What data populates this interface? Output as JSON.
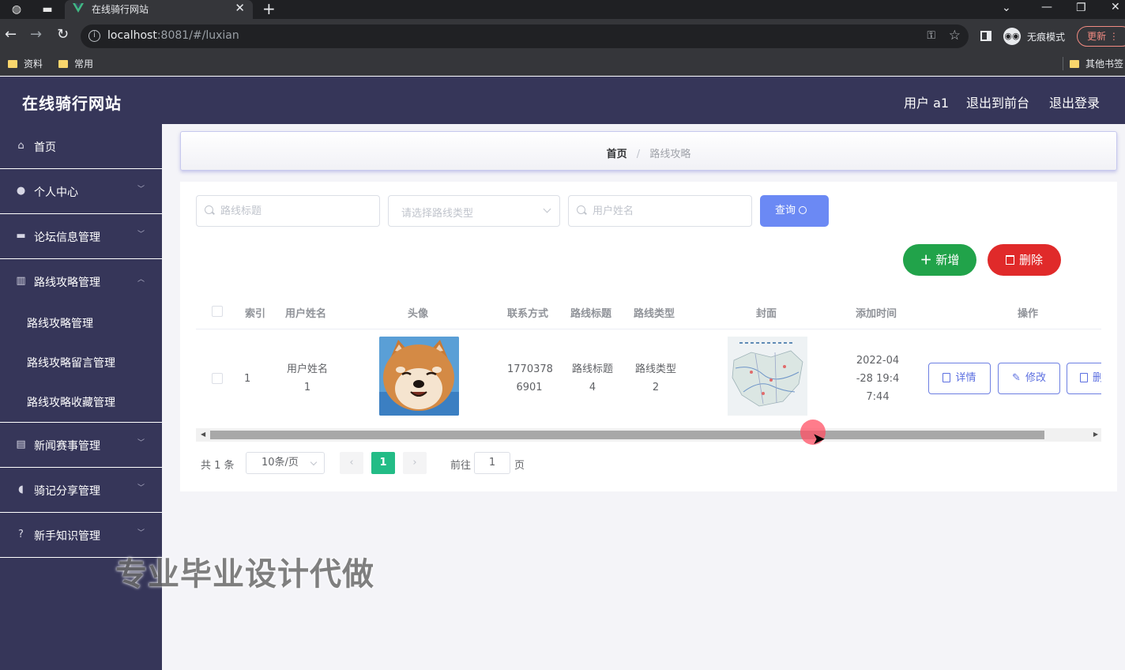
{
  "browser": {
    "tab_title": "在线骑行网站",
    "url_host": "localhost",
    "url_rest": ":8081/#/luxian",
    "incognito_label": "无痕模式",
    "update_label": "更新",
    "bookmarks": [
      "资料",
      "常用"
    ],
    "other_bookmarks": "其他书签"
  },
  "header": {
    "title": "在线骑行网站",
    "links": [
      "用户 a1",
      "退出到前台",
      "退出登录"
    ]
  },
  "sidebar": {
    "items": [
      {
        "label": "首页",
        "icon": "home-icon"
      },
      {
        "label": "个人中心",
        "icon": "user-icon"
      },
      {
        "label": "论坛信息管理",
        "icon": "briefcase-icon"
      },
      {
        "label": "路线攻略管理",
        "icon": "library-icon"
      },
      {
        "label": "新闻赛事管理",
        "icon": "chat-icon"
      },
      {
        "label": "骑记分享管理",
        "icon": "bulb-icon"
      },
      {
        "label": "新手知识管理",
        "icon": "help-icon"
      }
    ],
    "submenu": [
      "路线攻略管理",
      "路线攻略留言管理",
      "路线攻略收藏管理"
    ]
  },
  "breadcrumb": {
    "home": "首页",
    "sep": "/",
    "current": "路线攻略"
  },
  "search": {
    "title_placeholder": "路线标题",
    "type_placeholder": "请选择路线类型",
    "user_placeholder": "用户姓名",
    "query_label": "查询"
  },
  "actions": {
    "add_label": "新增",
    "delete_label": "删除"
  },
  "table": {
    "headers": [
      "索引",
      "用户姓名",
      "头像",
      "联系方式",
      "路线标题",
      "路线类型",
      "封面",
      "添加时间",
      "操作"
    ],
    "row": {
      "index": "1",
      "user_line1": "用户姓名",
      "user_line2": "1",
      "phone_line1": "1770378",
      "phone_line2": "6901",
      "title_line1": "路线标题",
      "title_line2": "4",
      "type_line1": "路线类型",
      "type_line2": "2",
      "time_line1": "2022-04",
      "time_line2": "-28 19:4",
      "time_line3": "7:44"
    },
    "row_actions": {
      "detail": "详情",
      "edit": "修改",
      "delete": "删"
    }
  },
  "pagination": {
    "total": "共 1 条",
    "page_size": "10条/页",
    "current_page": "1",
    "goto_label": "前往",
    "goto_value": "1",
    "page_suffix": "页"
  },
  "watermark": "专业毕业设计代做",
  "colors": {
    "sidebar_bg": "#363659",
    "primary": "#6b89f4",
    "success": "#21a34a",
    "danger": "#e02a2a",
    "pager_active": "#23bc86"
  }
}
